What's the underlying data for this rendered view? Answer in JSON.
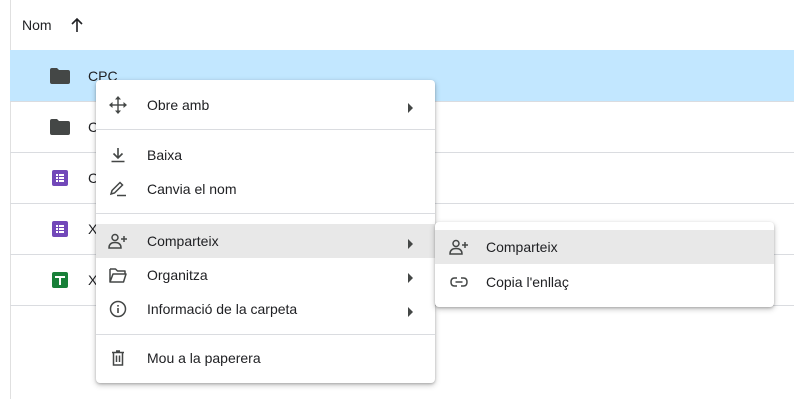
{
  "header": {
    "name_col": "Nom",
    "sort_icon": "arrow-up-icon"
  },
  "files": [
    {
      "name": "CPC",
      "icon": "folder-icon",
      "selected": true
    },
    {
      "name": "C",
      "icon": "folder-icon"
    },
    {
      "name": "C",
      "icon": "forms-icon"
    },
    {
      "name": "X",
      "icon": "forms-icon"
    },
    {
      "name": "X",
      "icon": "sheets-icon"
    }
  ],
  "context_menu": {
    "open_with": "Obre amb",
    "download": "Baixa",
    "rename": "Canvia el nom",
    "share": "Comparteix",
    "organize": "Organitza",
    "folder_info": "Informació de la carpeta",
    "trash": "Mou a la paperera"
  },
  "share_submenu": {
    "share": "Comparteix",
    "copy_link": "Copia l'enllaç"
  },
  "colors": {
    "selected_row": "#c2e7ff",
    "folder": "#444746",
    "forms": "#7248b9",
    "sheets": "#188038",
    "hover": "#e8e8e8"
  }
}
